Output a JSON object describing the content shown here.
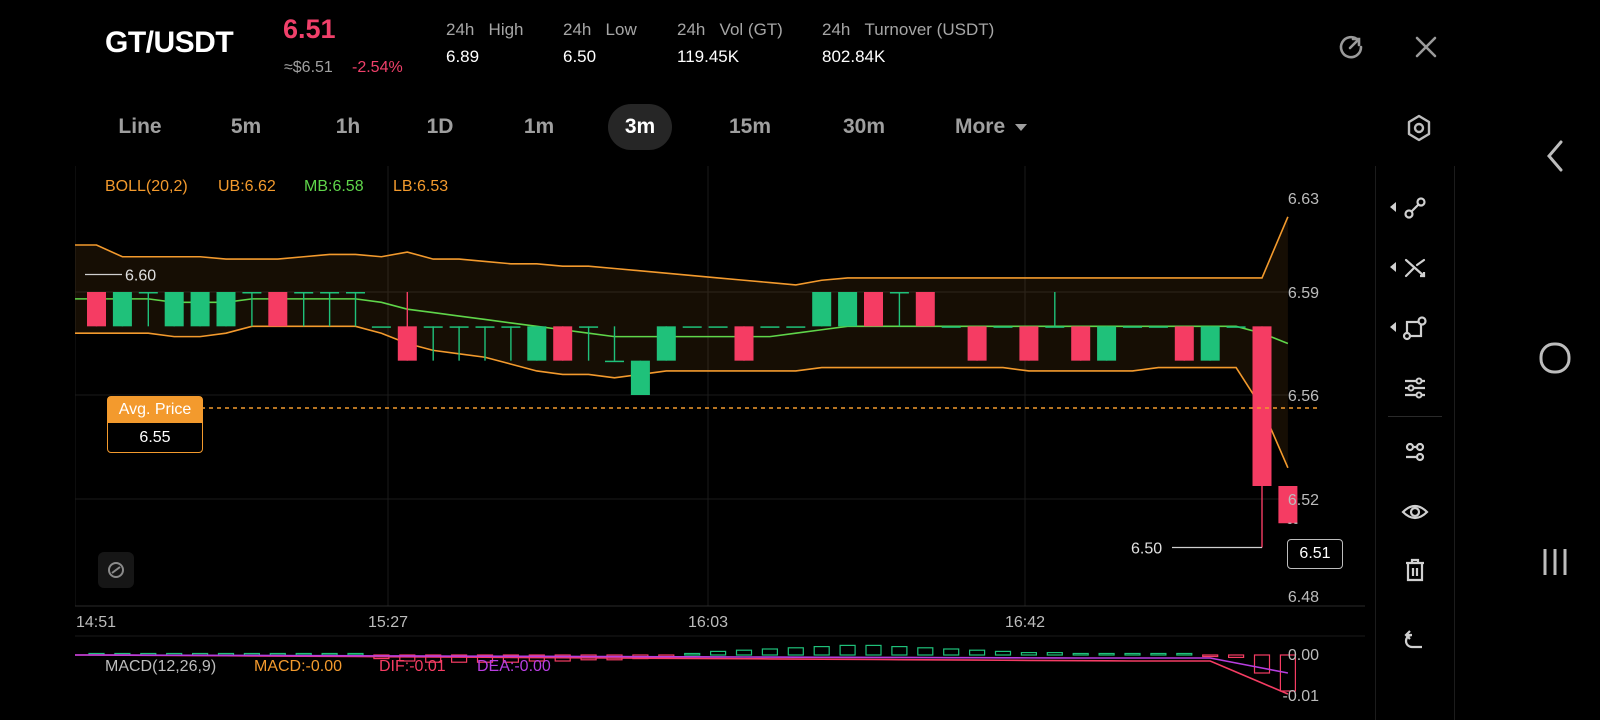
{
  "header": {
    "pair": "GT/USDT",
    "price": "6.51",
    "usd_price": "≈$6.51",
    "change_pct": "-2.54%",
    "stats": [
      {
        "period": "24h",
        "label": "High",
        "value": "6.89"
      },
      {
        "period": "24h",
        "label": "Low",
        "value": "6.50"
      },
      {
        "period": "24h",
        "label": "Vol (GT)",
        "value": "119.45K"
      },
      {
        "period": "24h",
        "label": "Turnover (USDT)",
        "value": "802.84K"
      }
    ]
  },
  "tabs": {
    "line": "Line",
    "m5": "5m",
    "h1": "1h",
    "d1": "1D",
    "m1": "1m",
    "m3": "3m",
    "m15": "15m",
    "m30": "30m",
    "more": "More",
    "active": "3m"
  },
  "indicators": {
    "boll": {
      "name": "BOLL(20,2)",
      "ub": "UB:6.62",
      "mb": "MB:6.58",
      "lb": "LB:6.53"
    },
    "macd": {
      "name": "MACD(12,26,9)",
      "macd": "MACD:-0.00",
      "dif": "DIF:-0.01",
      "dea": "DEA:-0.00"
    }
  },
  "markers": {
    "avg_price_label": "Avg. Price",
    "avg_price_value": "6.55",
    "last_price": "6.51",
    "low_mark": "6.50",
    "high_mark": "6.60"
  },
  "colors": {
    "up": "#1fc17a",
    "down": "#f53c63",
    "boll_band": "#f39a2d",
    "boll_mb": "#5fd54a",
    "dif": "#f53c63",
    "dea": "#b83ee0",
    "macd_label": "#f39a2d"
  },
  "chart_data": {
    "type": "candlestick",
    "y_axis_ticks": [
      "6.63",
      "6.59",
      "6.56",
      "6.52",
      "6.48"
    ],
    "x_axis_ticks": [
      "14:51",
      "15:27",
      "16:03",
      "16:42"
    ],
    "ylim": [
      6.48,
      6.63
    ],
    "candles": [
      {
        "o": 6.59,
        "c": 6.58,
        "h": 6.59,
        "l": 6.58
      },
      {
        "o": 6.58,
        "c": 6.59,
        "h": 6.59,
        "l": 6.58
      },
      {
        "o": 6.59,
        "c": 6.59,
        "h": 6.59,
        "l": 6.58
      },
      {
        "o": 6.58,
        "c": 6.59,
        "h": 6.59,
        "l": 6.58
      },
      {
        "o": 6.58,
        "c": 6.59,
        "h": 6.59,
        "l": 6.58
      },
      {
        "o": 6.58,
        "c": 6.59,
        "h": 6.59,
        "l": 6.58
      },
      {
        "o": 6.59,
        "c": 6.59,
        "h": 6.59,
        "l": 6.58
      },
      {
        "o": 6.59,
        "c": 6.58,
        "h": 6.59,
        "l": 6.58
      },
      {
        "o": 6.59,
        "c": 6.59,
        "h": 6.59,
        "l": 6.58
      },
      {
        "o": 6.59,
        "c": 6.59,
        "h": 6.59,
        "l": 6.58
      },
      {
        "o": 6.59,
        "c": 6.59,
        "h": 6.59,
        "l": 6.58
      },
      {
        "o": 6.58,
        "c": 6.58,
        "h": 6.58,
        "l": 6.58
      },
      {
        "o": 6.58,
        "c": 6.57,
        "h": 6.59,
        "l": 6.57
      },
      {
        "o": 6.58,
        "c": 6.58,
        "h": 6.58,
        "l": 6.57
      },
      {
        "o": 6.58,
        "c": 6.58,
        "h": 6.58,
        "l": 6.57
      },
      {
        "o": 6.58,
        "c": 6.58,
        "h": 6.58,
        "l": 6.57
      },
      {
        "o": 6.58,
        "c": 6.58,
        "h": 6.58,
        "l": 6.57
      },
      {
        "o": 6.57,
        "c": 6.58,
        "h": 6.58,
        "l": 6.57
      },
      {
        "o": 6.58,
        "c": 6.57,
        "h": 6.58,
        "l": 6.57
      },
      {
        "o": 6.58,
        "c": 6.58,
        "h": 6.58,
        "l": 6.57
      },
      {
        "o": 6.57,
        "c": 6.57,
        "h": 6.58,
        "l": 6.57
      },
      {
        "o": 6.56,
        "c": 6.57,
        "h": 6.57,
        "l": 6.56
      },
      {
        "o": 6.57,
        "c": 6.58,
        "h": 6.58,
        "l": 6.57
      },
      {
        "o": 6.58,
        "c": 6.58,
        "h": 6.58,
        "l": 6.58
      },
      {
        "o": 6.58,
        "c": 6.58,
        "h": 6.58,
        "l": 6.58
      },
      {
        "o": 6.58,
        "c": 6.57,
        "h": 6.58,
        "l": 6.57
      },
      {
        "o": 6.58,
        "c": 6.58,
        "h": 6.58,
        "l": 6.58
      },
      {
        "o": 6.58,
        "c": 6.58,
        "h": 6.58,
        "l": 6.58
      },
      {
        "o": 6.58,
        "c": 6.59,
        "h": 6.59,
        "l": 6.58
      },
      {
        "o": 6.58,
        "c": 6.59,
        "h": 6.59,
        "l": 6.58
      },
      {
        "o": 6.59,
        "c": 6.58,
        "h": 6.59,
        "l": 6.58
      },
      {
        "o": 6.59,
        "c": 6.59,
        "h": 6.59,
        "l": 6.58
      },
      {
        "o": 6.59,
        "c": 6.58,
        "h": 6.59,
        "l": 6.58
      },
      {
        "o": 6.58,
        "c": 6.58,
        "h": 6.58,
        "l": 6.58
      },
      {
        "o": 6.58,
        "c": 6.57,
        "h": 6.58,
        "l": 6.57
      },
      {
        "o": 6.58,
        "c": 6.58,
        "h": 6.58,
        "l": 6.58
      },
      {
        "o": 6.58,
        "c": 6.57,
        "h": 6.58,
        "l": 6.57
      },
      {
        "o": 6.58,
        "c": 6.58,
        "h": 6.59,
        "l": 6.58
      },
      {
        "o": 6.58,
        "c": 6.57,
        "h": 6.58,
        "l": 6.57
      },
      {
        "o": 6.57,
        "c": 6.58,
        "h": 6.58,
        "l": 6.57
      },
      {
        "o": 6.58,
        "c": 6.58,
        "h": 6.58,
        "l": 6.58
      },
      {
        "o": 6.58,
        "c": 6.58,
        "h": 6.58,
        "l": 6.58
      },
      {
        "o": 6.58,
        "c": 6.57,
        "h": 6.58,
        "l": 6.57
      },
      {
        "o": 6.57,
        "c": 6.58,
        "h": 6.58,
        "l": 6.57
      },
      {
        "o": 6.58,
        "c": 6.58,
        "h": 6.58,
        "l": 6.58
      },
      {
        "o": 6.58,
        "c": 6.525,
        "h": 6.58,
        "l": 6.5
      },
      {
        "o": 6.525,
        "c": 6.51,
        "h": 6.525,
        "l": 6.51
      }
    ],
    "boll_upper": [
      6.61,
      6.605,
      6.605,
      6.605,
      6.605,
      6.604,
      6.604,
      6.604,
      6.605,
      6.606,
      6.606,
      6.605,
      6.607,
      6.604,
      6.604,
      6.603,
      6.602,
      6.602,
      6.601,
      6.601,
      6.6,
      6.599,
      6.598,
      6.597,
      6.596,
      6.595,
      6.594,
      6.593,
      6.595,
      6.596,
      6.596,
      6.596,
      6.596,
      6.596,
      6.596,
      6.596,
      6.596,
      6.596,
      6.596,
      6.596,
      6.596,
      6.596,
      6.596,
      6.596,
      6.596,
      6.596,
      6.622
    ],
    "boll_mid": [
      6.588,
      6.588,
      6.588,
      6.587,
      6.587,
      6.587,
      6.588,
      6.588,
      6.588,
      6.588,
      6.588,
      6.587,
      6.585,
      6.584,
      6.583,
      6.582,
      6.581,
      6.58,
      6.579,
      6.578,
      6.577,
      6.577,
      6.577,
      6.577,
      6.577,
      6.577,
      6.577,
      6.578,
      6.579,
      6.58,
      6.58,
      6.58,
      6.58,
      6.58,
      6.58,
      6.58,
      6.58,
      6.58,
      6.58,
      6.58,
      6.58,
      6.58,
      6.58,
      6.58,
      6.58,
      6.578,
      6.575
    ],
    "boll_lower": [
      6.578,
      6.578,
      6.578,
      6.577,
      6.577,
      6.578,
      6.58,
      6.58,
      6.58,
      6.58,
      6.58,
      6.578,
      6.575,
      6.573,
      6.572,
      6.571,
      6.569,
      6.567,
      6.566,
      6.566,
      6.565,
      6.566,
      6.567,
      6.567,
      6.567,
      6.567,
      6.567,
      6.567,
      6.568,
      6.568,
      6.568,
      6.568,
      6.568,
      6.568,
      6.568,
      6.568,
      6.567,
      6.567,
      6.567,
      6.567,
      6.567,
      6.568,
      6.568,
      6.568,
      6.568,
      6.555,
      6.532
    ],
    "macd_ticks": [
      "0.00",
      "-0.01"
    ],
    "macd_hist": [
      0,
      0,
      0,
      0,
      0,
      0,
      0,
      0,
      0,
      0,
      0,
      -0.0003,
      -0.0005,
      -0.0006,
      -0.0006,
      -0.0006,
      -0.0006,
      -0.0005,
      -0.0005,
      -0.0004,
      -0.0004,
      -0.0003,
      -0.0001,
      0.0001,
      0.0003,
      0.0004,
      0.0005,
      0.0006,
      0.0007,
      0.0008,
      0.0008,
      0.0007,
      0.0006,
      0.0005,
      0.0004,
      0.0003,
      0.0002,
      0.0002,
      0.0001,
      0.0001,
      0.0001,
      0.0001,
      0,
      -0.0001,
      -0.0002,
      -0.0015,
      -0.003
    ]
  }
}
